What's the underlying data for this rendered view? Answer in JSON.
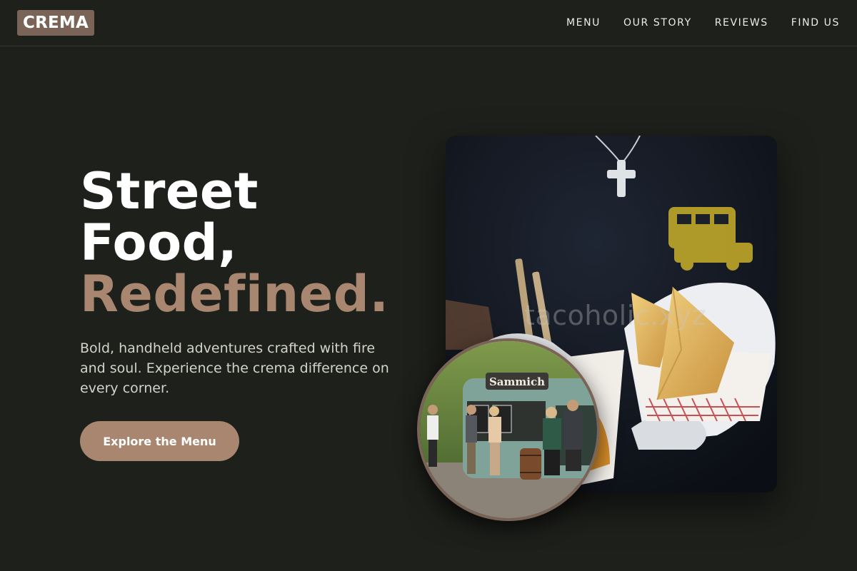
{
  "brand": {
    "logo": "CREMA"
  },
  "nav": {
    "items": [
      "MENU",
      "OUR STORY",
      "REVIEWS",
      "FIND US"
    ]
  },
  "hero": {
    "title_line1": "Street",
    "title_line2": "Food,",
    "title_accent": "Redefined.",
    "subtitle": "Bold, handheld adventures crafted with fire and soul. Experience the crema difference on every corner.",
    "cta_label": "Explore the Menu"
  },
  "images": {
    "main": {
      "watermark": "tacoholic.xyz"
    },
    "inset": {
      "truck_sign": "Sammich"
    }
  },
  "colors": {
    "background": "#1e201c",
    "accent": "#a8866f",
    "logo_bg": "#7a6458"
  }
}
